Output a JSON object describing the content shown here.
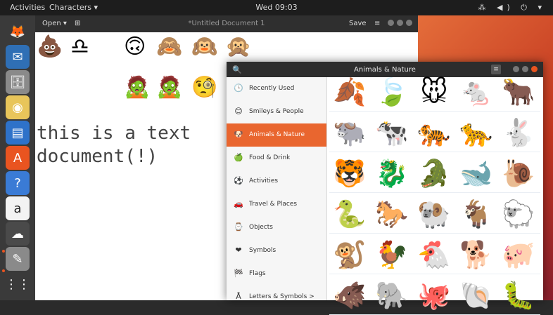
{
  "topbar": {
    "activities": "Activities",
    "app_menu": "Characters ▾",
    "clock": "Wed 09:03",
    "tray": "⁂ ◀) ⏻ ▾"
  },
  "dock": {
    "items": [
      {
        "name": "firefox-icon",
        "glyph": "🦊",
        "bg": "#3a3a3a"
      },
      {
        "name": "thunderbird-icon",
        "glyph": "✉",
        "bg": "#2f6fb5"
      },
      {
        "name": "files-icon",
        "glyph": "🗄",
        "bg": "#8a8a8a"
      },
      {
        "name": "rhythmbox-icon",
        "glyph": "◉",
        "bg": "#e8c55a"
      },
      {
        "name": "writer-icon",
        "glyph": "▤",
        "bg": "#2e72c9"
      },
      {
        "name": "software-icon",
        "glyph": "A",
        "bg": "#e95420"
      },
      {
        "name": "help-icon",
        "glyph": "?",
        "bg": "#3a7bd5"
      },
      {
        "name": "amazon-icon",
        "glyph": "a",
        "bg": "#f3f3f3"
      },
      {
        "name": "characters-icon",
        "glyph": "☁",
        "bg": "#4a4a4a"
      },
      {
        "name": "text-editor-icon",
        "glyph": "✎",
        "bg": "#8a8a8a"
      },
      {
        "name": "apps-grid-icon",
        "glyph": "⋮⋮",
        "bg": "#3a3a3a"
      }
    ]
  },
  "editor": {
    "open_label": "Open ▾",
    "new_tab_label": "⊞",
    "title": "*Untitled Document 1",
    "save_label": "Save",
    "menu_label": "≡",
    "emojis_row1": [
      "💩",
      "♎",
      "🙃",
      "🙈",
      "🙉",
      "🙊"
    ],
    "emojis_row2": [
      "🧟",
      "🧟",
      "🧐"
    ],
    "text_line1": "this is a text",
    "text_line2": "document(!)"
  },
  "characters": {
    "title": "Animals & Nature",
    "categories": [
      {
        "label": "Recently Used",
        "icon": "🕒",
        "name": "recently-used-icon"
      },
      {
        "label": "Smileys & People",
        "icon": "😊",
        "name": "smiley-icon"
      },
      {
        "label": "Animals & Nature",
        "icon": "🐶",
        "name": "animal-icon"
      },
      {
        "label": "Food & Drink",
        "icon": "🍏",
        "name": "apple-icon"
      },
      {
        "label": "Activities",
        "icon": "⚽",
        "name": "ball-icon"
      },
      {
        "label": "Travel & Places",
        "icon": "🚗",
        "name": "car-icon"
      },
      {
        "label": "Objects",
        "icon": "⌚",
        "name": "watch-icon"
      },
      {
        "label": "Symbols",
        "icon": "❤",
        "name": "heart-icon"
      },
      {
        "label": "Flags",
        "icon": "🏁",
        "name": "flag-icon"
      },
      {
        "label": "Letters & Symbols >",
        "icon": "Å",
        "name": "letters-icon"
      }
    ],
    "active_index": 2,
    "grid": [
      [
        "🍂",
        "🍃",
        "🐭",
        "🐁",
        "🐂"
      ],
      [
        "🐃",
        "🐄",
        "🐅",
        "🐆",
        "🐇"
      ],
      [
        "🐯",
        "🐉",
        "🐊",
        "🐋",
        "🐌"
      ],
      [
        "🐍",
        "🐎",
        "🐏",
        "🐐",
        "🐑"
      ],
      [
        "🐒",
        "🐓",
        "🐔",
        "🐕",
        "🐖"
      ],
      [
        "🐗",
        "🐘",
        "🐙",
        "🐚",
        "🐛"
      ]
    ]
  },
  "colors": {
    "accent": "#e9662f"
  }
}
